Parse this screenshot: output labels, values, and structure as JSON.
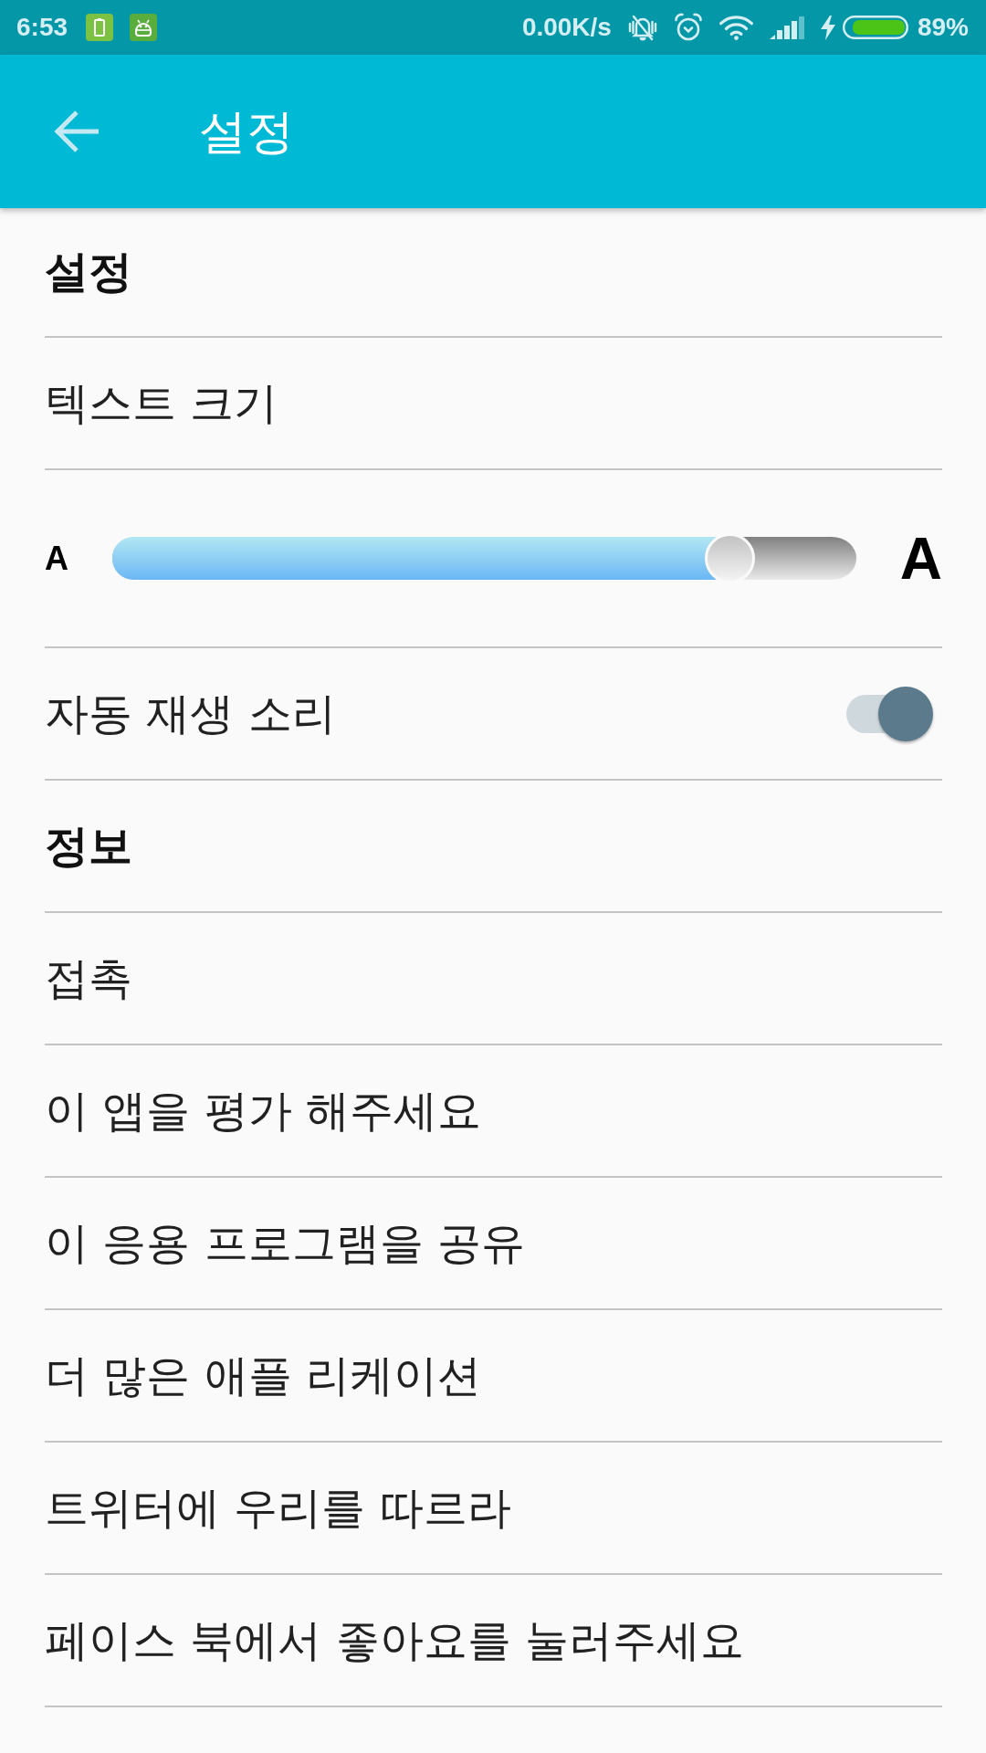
{
  "status_bar": {
    "time": "6:53",
    "network_speed": "0.00K/s",
    "battery_percent": "89%"
  },
  "app_bar": {
    "title": "설정"
  },
  "items": [
    {
      "kind": "header",
      "label": "설정"
    },
    {
      "kind": "item",
      "label": "텍스트 크기"
    },
    {
      "kind": "slider",
      "min_label": "A",
      "max_label": "A",
      "level": 0.83
    },
    {
      "kind": "toggle",
      "label": "자동 재생 소리",
      "on": true
    },
    {
      "kind": "header",
      "label": "정보"
    },
    {
      "kind": "item",
      "label": "접촉"
    },
    {
      "kind": "item",
      "label": "이 앱을 평가 해주세요"
    },
    {
      "kind": "item",
      "label": "이 응용 프로그램을 공유"
    },
    {
      "kind": "item",
      "label": "더 많은 애플 리케이션"
    },
    {
      "kind": "item",
      "label": "트위터에 우리를 따르라"
    },
    {
      "kind": "item",
      "label": "페이스 북에서 좋아요를 눌러주세요"
    }
  ]
}
